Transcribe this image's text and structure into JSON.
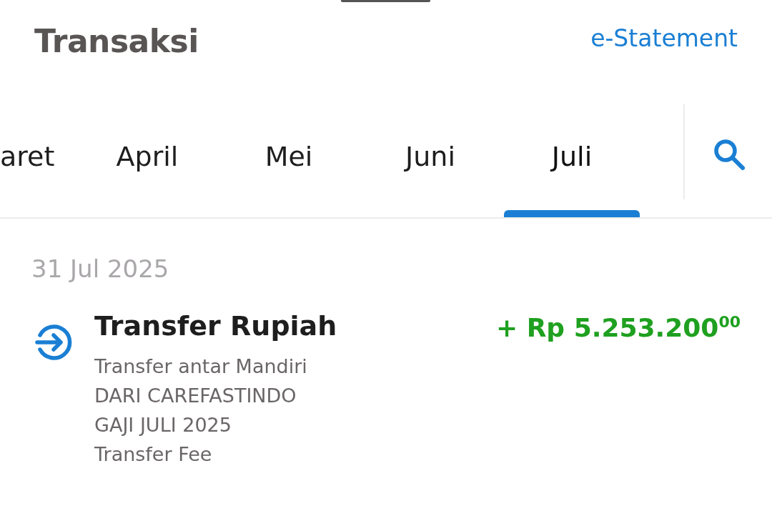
{
  "header": {
    "title": "Transaksi",
    "link": "e-Statement"
  },
  "tabs": [
    {
      "label": "aret",
      "selected": false
    },
    {
      "label": "April",
      "selected": false
    },
    {
      "label": "Mei",
      "selected": false
    },
    {
      "label": "Juni",
      "selected": false
    },
    {
      "label": "Juli",
      "selected": true
    }
  ],
  "groups": [
    {
      "date": "31 Jul 2025",
      "transactions": [
        {
          "kind": "incoming",
          "title": "Transfer Rupiah",
          "details": [
            "Transfer antar Mandiri",
            "DARI CAREFASTINDO",
            "GAJI JULI 2025",
            "Transfer Fee"
          ],
          "amount": "+ Rp 5.253.200$^{00}$"
        }
      ]
    }
  ]
}
